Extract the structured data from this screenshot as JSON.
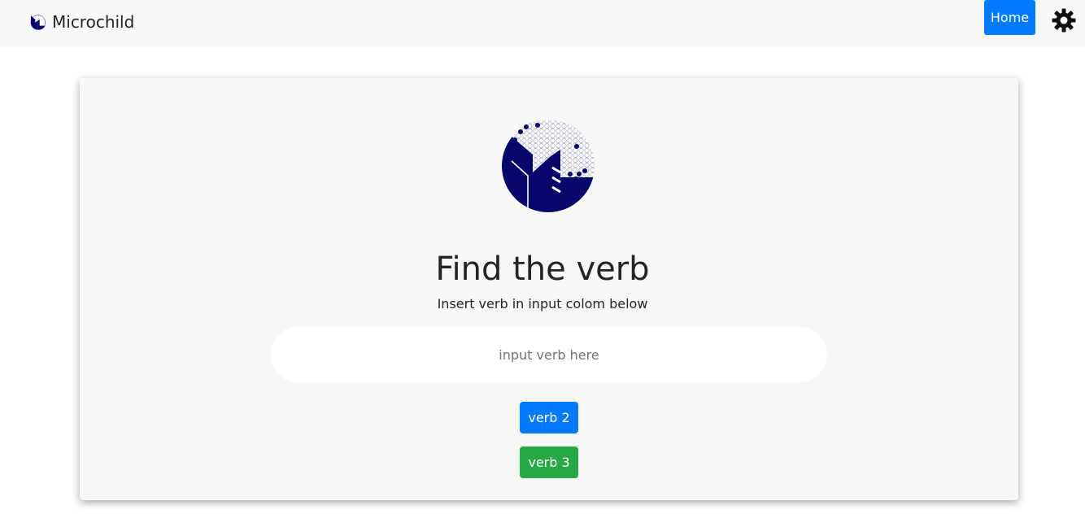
{
  "navbar": {
    "brand_text": "Microchild",
    "brand_icon": "microchild-logo-icon",
    "home_label": "Home",
    "settings_icon": "gear-icon"
  },
  "main": {
    "logo_icon": "microchild-logo-icon",
    "title": "Find the verb",
    "subtitle": "Insert verb in input colom below",
    "input_placeholder": "input verb here",
    "input_value": "",
    "verb2_label": "verb 2",
    "verb3_label": "verb 3"
  },
  "colors": {
    "primary": "#007bff",
    "success": "#28a745",
    "logo_navy": "#06066b",
    "navbar_bg": "#f8f8f8",
    "card_bg": "#f8f7f6"
  }
}
